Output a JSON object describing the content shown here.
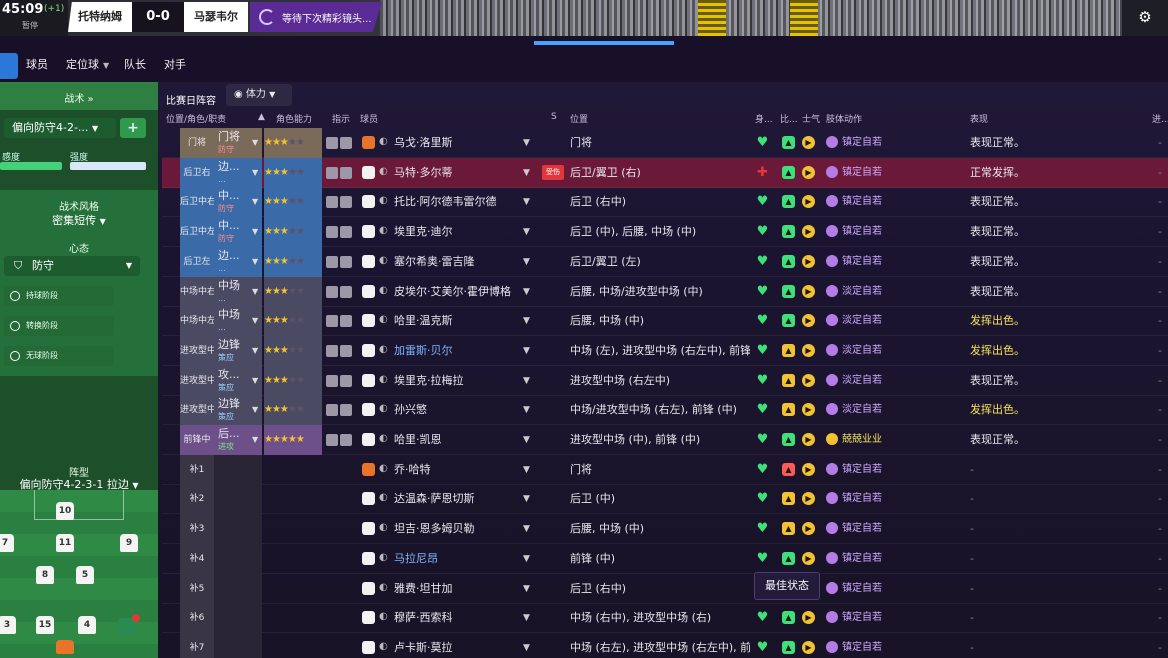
{
  "topbar": {
    "clock": "45:09",
    "added": "(+1)",
    "paused": "暂停",
    "home_team": "托特纳姆",
    "score": "0-0",
    "away_team": "马瑟韦尔",
    "waiting": "等待下次精彩镜头..."
  },
  "nav": {
    "items": [
      "球员",
      "定位球",
      "队长",
      "对手"
    ]
  },
  "left": {
    "tactic_header": "战术",
    "formation_select": "偏向防守4-2-...",
    "label_a": "感度",
    "label_b": "强度",
    "style_label": "战术风格",
    "style_value": "密集短传",
    "mentality_label": "心态",
    "mentality_value": "防守",
    "phases": [
      "持球阶段",
      "转换阶段",
      "无球阶段"
    ],
    "formation_label": "阵型",
    "formation_value": "偏向防守4-2-3-1 拉边",
    "pitch_numbers": [
      "10",
      "7",
      "11",
      "9",
      "8",
      "5",
      "3",
      "15",
      "4"
    ]
  },
  "table": {
    "filter_label": "比赛日阵容",
    "view_label": "体力",
    "headers": {
      "position_role": "位置/角色/职责",
      "role_ability": "角色能力",
      "instructions": "指示",
      "player": "球员",
      "s": "S",
      "position": "位置",
      "body": "身...",
      "match": "比...",
      "morale": "士气",
      "body_language": "肢体动作",
      "performance": "表现",
      "progress": "进..."
    },
    "tooltip": "最佳状态",
    "colors": {
      "gk": "#7a6a5a",
      "def": "#3a6aa8",
      "mid": "#4b4a63",
      "att": "#6d4f8a",
      "sub": "#3a3544",
      "inj": "#a01e3c"
    },
    "rows": [
      {
        "pos": "门将",
        "role": "门将",
        "duty": "防守",
        "duty_color": "#ff8b8b",
        "stars": 3,
        "half": false,
        "name": "乌戈·洛里斯",
        "position": "门将",
        "injured": false,
        "mood": "镇定自若",
        "perf": "表现正常。",
        "perf_color": "#e8e8ee",
        "shirt": "#e8742a",
        "kind": "gk",
        "name_color": "#e8e8ee"
      },
      {
        "pos": "后卫右",
        "role": "边...",
        "duty": "...",
        "duty_color": "#9cd0ff",
        "stars": 3,
        "half": false,
        "name": "马特·多尔蒂",
        "position": "后卫/翼卫 (右)",
        "injured": true,
        "injury_tag": "受伤",
        "mood": "镇定自若",
        "perf": "正常发挥。",
        "perf_color": "#e8e8ee",
        "shirt": "#f2f2f2",
        "kind": "def",
        "name_color": "#e8e8ee"
      },
      {
        "pos": "后卫中右",
        "role": "中...",
        "duty": "防守",
        "duty_color": "#ff8b8b",
        "stars": 3,
        "half": false,
        "name": "托比·阿尔德韦雷尔德",
        "position": "后卫 (右中)",
        "injured": false,
        "mood": "镇定自若",
        "perf": "表现正常。",
        "perf_color": "#e8e8ee",
        "shirt": "#f2f2f2",
        "kind": "def",
        "name_color": "#e8e8ee"
      },
      {
        "pos": "后卫中左",
        "role": "中...",
        "duty": "防守",
        "duty_color": "#ff8b8b",
        "stars": 3,
        "half": false,
        "name": "埃里克·迪尔",
        "position": "后卫 (中), 后腰, 中场 (中)",
        "injured": false,
        "mood": "镇定自若",
        "perf": "表现正常。",
        "perf_color": "#e8e8ee",
        "shirt": "#f2f2f2",
        "kind": "def",
        "name_color": "#e8e8ee"
      },
      {
        "pos": "后卫左",
        "role": "边...",
        "duty": "...",
        "duty_color": "#9cd0ff",
        "stars": 3,
        "half": false,
        "name": "塞尔希奥·雷吉隆",
        "position": "后卫/翼卫 (左)",
        "injured": false,
        "mood": "镇定自若",
        "perf": "表现正常。",
        "perf_color": "#e8e8ee",
        "shirt": "#f2f2f2",
        "kind": "def",
        "name_color": "#e8e8ee"
      },
      {
        "pos": "中场中右",
        "role": "中场",
        "duty": "...",
        "duty_color": "#9cd0ff",
        "stars": 3,
        "half": false,
        "name": "皮埃尔·艾美尔·霍伊博格",
        "position": "后腰, 中场/进攻型中场 (中)",
        "injured": false,
        "mood": "淡定自若",
        "perf": "表现正常。",
        "perf_color": "#e8e8ee",
        "shirt": "#f2f2f2",
        "kind": "mid",
        "name_color": "#e8e8ee"
      },
      {
        "pos": "中场中左",
        "role": "中场",
        "duty": "...",
        "duty_color": "#9cd0ff",
        "stars": 2,
        "half": true,
        "name": "哈里·温克斯",
        "position": "后腰, 中场 (中)",
        "injured": false,
        "mood": "淡定自若",
        "perf": "发挥出色。",
        "perf_color": "#f5e35a",
        "shirt": "#f2f2f2",
        "kind": "mid",
        "name_color": "#e8e8ee"
      },
      {
        "pos": "进攻型中...",
        "role": "边锋",
        "duty": "策应",
        "duty_color": "#9cd0ff",
        "stars": 2,
        "half": true,
        "name": "加雷斯·贝尔",
        "position": "中场 (左), 进攻型中场 (右左中), 前锋 (中)",
        "injured": false,
        "mood": "淡定自若",
        "perf": "发挥出色。",
        "perf_color": "#f5e35a",
        "shirt": "#f2f2f2",
        "kind": "mid",
        "name_color": "#7fb8ff"
      },
      {
        "pos": "进攻型中...",
        "role": "攻...",
        "duty": "策应",
        "duty_color": "#9cd0ff",
        "stars": 2,
        "half": true,
        "name": "埃里克·拉梅拉",
        "position": "进攻型中场 (右左中)",
        "injured": false,
        "mood": "淡定自若",
        "perf": "表现正常。",
        "perf_color": "#e8e8ee",
        "shirt": "#f2f2f2",
        "kind": "mid",
        "name_color": "#e8e8ee"
      },
      {
        "pos": "进攻型中...",
        "role": "边锋",
        "duty": "策应",
        "duty_color": "#9cd0ff",
        "stars": 3,
        "half": false,
        "name": "孙兴慜",
        "position": "中场/进攻型中场 (右左), 前锋 (中)",
        "injured": false,
        "mood": "淡定自若",
        "perf": "发挥出色。",
        "perf_color": "#f5e35a",
        "shirt": "#f2f2f2",
        "kind": "mid",
        "name_color": "#e8e8ee"
      },
      {
        "pos": "前锋中",
        "role": "后...",
        "duty": "进攻",
        "duty_color": "#7ee07e",
        "stars": 4,
        "half": true,
        "name": "哈里·凯恩",
        "position": "进攻型中场 (中), 前锋 (中)",
        "injured": false,
        "mood": "兢兢业业",
        "perf": "表现正常。",
        "perf_color": "#e8e8ee",
        "shirt": "#f2f2f2",
        "kind": "att",
        "name_color": "#e8e8ee"
      },
      {
        "pos": "补1",
        "role": "",
        "duty": "",
        "duty_color": "#fff",
        "stars": 0,
        "half": false,
        "name": "乔·哈特",
        "position": "门将",
        "injured": false,
        "mood": "镇定自若",
        "perf": "-",
        "perf_color": "#888",
        "shirt": "#e8742a",
        "kind": "sub",
        "name_color": "#e8e8ee"
      },
      {
        "pos": "补2",
        "role": "",
        "duty": "",
        "duty_color": "#fff",
        "stars": 0,
        "half": false,
        "name": "达温森·萨恩切斯",
        "position": "后卫 (中)",
        "injured": false,
        "mood": "镇定自若",
        "perf": "-",
        "perf_color": "#888",
        "shirt": "#f2f2f2",
        "kind": "sub",
        "name_color": "#e8e8ee"
      },
      {
        "pos": "补3",
        "role": "",
        "duty": "",
        "duty_color": "#fff",
        "stars": 0,
        "half": false,
        "name": "坦吉·恩多姆贝勒",
        "position": "后腰, 中场 (中)",
        "injured": false,
        "mood": "镇定自若",
        "perf": "-",
        "perf_color": "#888",
        "shirt": "#f2f2f2",
        "kind": "sub",
        "name_color": "#e8e8ee"
      },
      {
        "pos": "补4",
        "role": "",
        "duty": "",
        "duty_color": "#fff",
        "stars": 0,
        "half": false,
        "name": "马拉尼昂",
        "position": "前锋 (中)",
        "injured": false,
        "mood": "镇定自若",
        "perf": "-",
        "perf_color": "#888",
        "shirt": "#f2f2f2",
        "kind": "sub",
        "name_color": "#7fb8ff"
      },
      {
        "pos": "补5",
        "role": "",
        "duty": "",
        "duty_color": "#fff",
        "stars": 0,
        "half": false,
        "name": "雅费·坦甘加",
        "position": "后卫 (右中)",
        "injured": false,
        "mood": "镇定自若",
        "perf": "-",
        "perf_color": "#888",
        "shirt": "#f2f2f2",
        "kind": "sub",
        "name_color": "#e8e8ee"
      },
      {
        "pos": "补6",
        "role": "",
        "duty": "",
        "duty_color": "#fff",
        "stars": 0,
        "half": false,
        "name": "穆萨·西索科",
        "position": "中场 (右中), 进攻型中场 (右)",
        "injured": false,
        "mood": "镇定自若",
        "perf": "-",
        "perf_color": "#888",
        "shirt": "#f2f2f2",
        "kind": "sub",
        "name_color": "#e8e8ee"
      },
      {
        "pos": "补7",
        "role": "",
        "duty": "",
        "duty_color": "#fff",
        "stars": 0,
        "half": false,
        "name": "卢卡斯·莫拉",
        "position": "中场 (右左), 进攻型中场 (右左中), 前锋 (中)",
        "injured": false,
        "mood": "镇定自若",
        "perf": "-",
        "perf_color": "#888",
        "shirt": "#f2f2f2",
        "kind": "sub",
        "name_color": "#e8e8ee"
      }
    ]
  }
}
